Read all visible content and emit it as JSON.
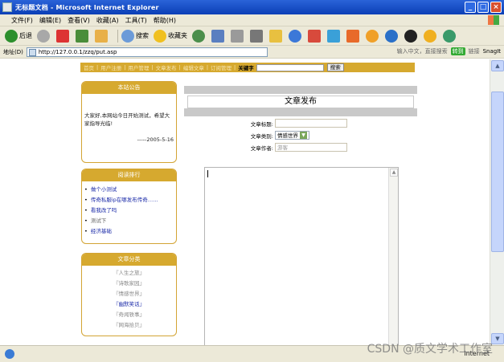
{
  "window": {
    "title": "无标题文档 - Microsoft Internet Explorer"
  },
  "menubar": [
    "文件(F)",
    "编辑(E)",
    "查看(V)",
    "收藏(A)",
    "工具(T)",
    "帮助(H)"
  ],
  "toolbar": {
    "back_label": "后退",
    "search_label": "搜索",
    "favorites_label": "收藏夹"
  },
  "address": {
    "label": "地址(D)",
    "url": "http://127.0.0.1/zzq/put.asp",
    "hint": "输入中文，直接搜索",
    "go_label": "转到",
    "links_label": "链接",
    "snagit_label": "SnagIt"
  },
  "sitenav": {
    "items": [
      "首页",
      "用户注册",
      "用户管理",
      "文章发布",
      "编辑文章",
      "订阅管理"
    ],
    "keyword_label": "关键字",
    "search_button": "搜索"
  },
  "notice": {
    "title": "本站公告",
    "text": "大家好,本网站今日开始测试，希望大家指导光临!",
    "signature": "-----2005-5-16"
  },
  "ranking": {
    "title": "阅读排行",
    "items": [
      {
        "label": "做个小测试",
        "gray": false
      },
      {
        "label": "传奇私服ip在哪发布传奇……",
        "gray": false
      },
      {
        "label": "看我改了吗",
        "gray": false
      },
      {
        "label": "测试下",
        "gray": true
      },
      {
        "label": "经济基础",
        "gray": false
      }
    ]
  },
  "categories": {
    "title": "文章分类",
    "items": [
      {
        "label": "『人生之旅』",
        "active": false
      },
      {
        "label": "『诗歌家园』",
        "active": false
      },
      {
        "label": "『情感世界』",
        "active": false
      },
      {
        "label": "『幽默笑话』",
        "active": true
      },
      {
        "label": "『奇闻轶事』",
        "active": false
      },
      {
        "label": "『网海拾贝』",
        "active": false
      }
    ]
  },
  "form": {
    "heading": "文章发布",
    "title_label": "文章标题:",
    "title_value": "",
    "type_label": "文章类别:",
    "type_value": "情感世界",
    "author_label": "文章作者:",
    "author_value": "游客"
  },
  "statusbar": {
    "zone": "Internet"
  },
  "watermark": "CSDN @质文学术工作室",
  "colors": {
    "accent": "#d6a92f",
    "link": "#1a2aa8",
    "titlebar": "#0b3fb6"
  }
}
